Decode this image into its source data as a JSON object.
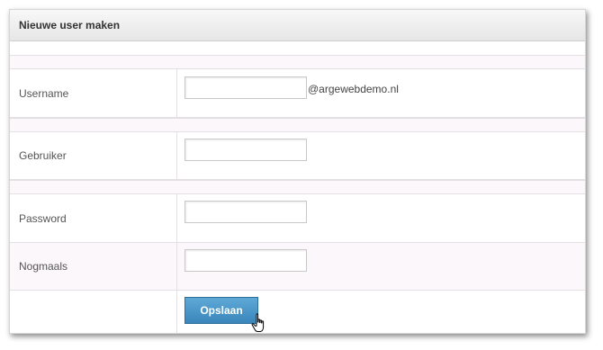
{
  "form": {
    "title": "Nieuwe user maken",
    "fields": {
      "username": {
        "label": "Username",
        "value": "",
        "suffix": "@argewebdemo.nl"
      },
      "gebruiker": {
        "label": "Gebruiker",
        "value": ""
      },
      "password": {
        "label": "Password",
        "value": ""
      },
      "nogmaals": {
        "label": "Nogmaals",
        "value": ""
      }
    },
    "save_label": "Opslaan"
  },
  "icons": {
    "cursor": "hand-pointer-cursor-icon"
  },
  "colors": {
    "button_blue": "#3a86bb",
    "row_alt_bg": "#fbf7fb",
    "header_bg": "#e6e6e6"
  }
}
